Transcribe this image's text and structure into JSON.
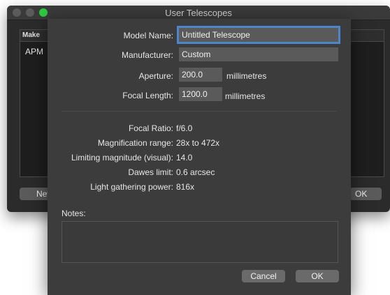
{
  "window": {
    "title": "User Telescopes"
  },
  "table": {
    "column_make": "Make",
    "rows": [
      "APM"
    ]
  },
  "bg_buttons": {
    "new_label": "New",
    "ok_label": "OK"
  },
  "form": {
    "model_name": {
      "label": "Model Name:",
      "value": "Untitled Telescope"
    },
    "manufacturer": {
      "label": "Manufacturer:",
      "value": "Custom"
    },
    "aperture": {
      "label": "Aperture:",
      "value": "200.0",
      "unit": "millimetres"
    },
    "focal_length": {
      "label": "Focal Length:",
      "value": "1200.0",
      "unit": "millimetres"
    }
  },
  "stats": {
    "focal_ratio": {
      "label": "Focal Ratio:",
      "value": "f/6.0"
    },
    "magnification_range": {
      "label": "Magnification range:",
      "value": "28x to 472x"
    },
    "limiting_magnitude": {
      "label": "Limiting magnitude (visual):",
      "value": "14.0"
    },
    "dawes_limit": {
      "label": "Dawes limit:",
      "value": "0.6 arcsec"
    },
    "light_gathering": {
      "label": "Light gathering power:",
      "value": "816x"
    }
  },
  "notes": {
    "label": "Notes:",
    "value": ""
  },
  "buttons": {
    "cancel_label": "Cancel",
    "ok_label": "OK"
  },
  "colors": {
    "focus_ring": "#4c85c9",
    "sheet_bg": "#3c3c3c",
    "field_bg": "#5a5a5a"
  }
}
